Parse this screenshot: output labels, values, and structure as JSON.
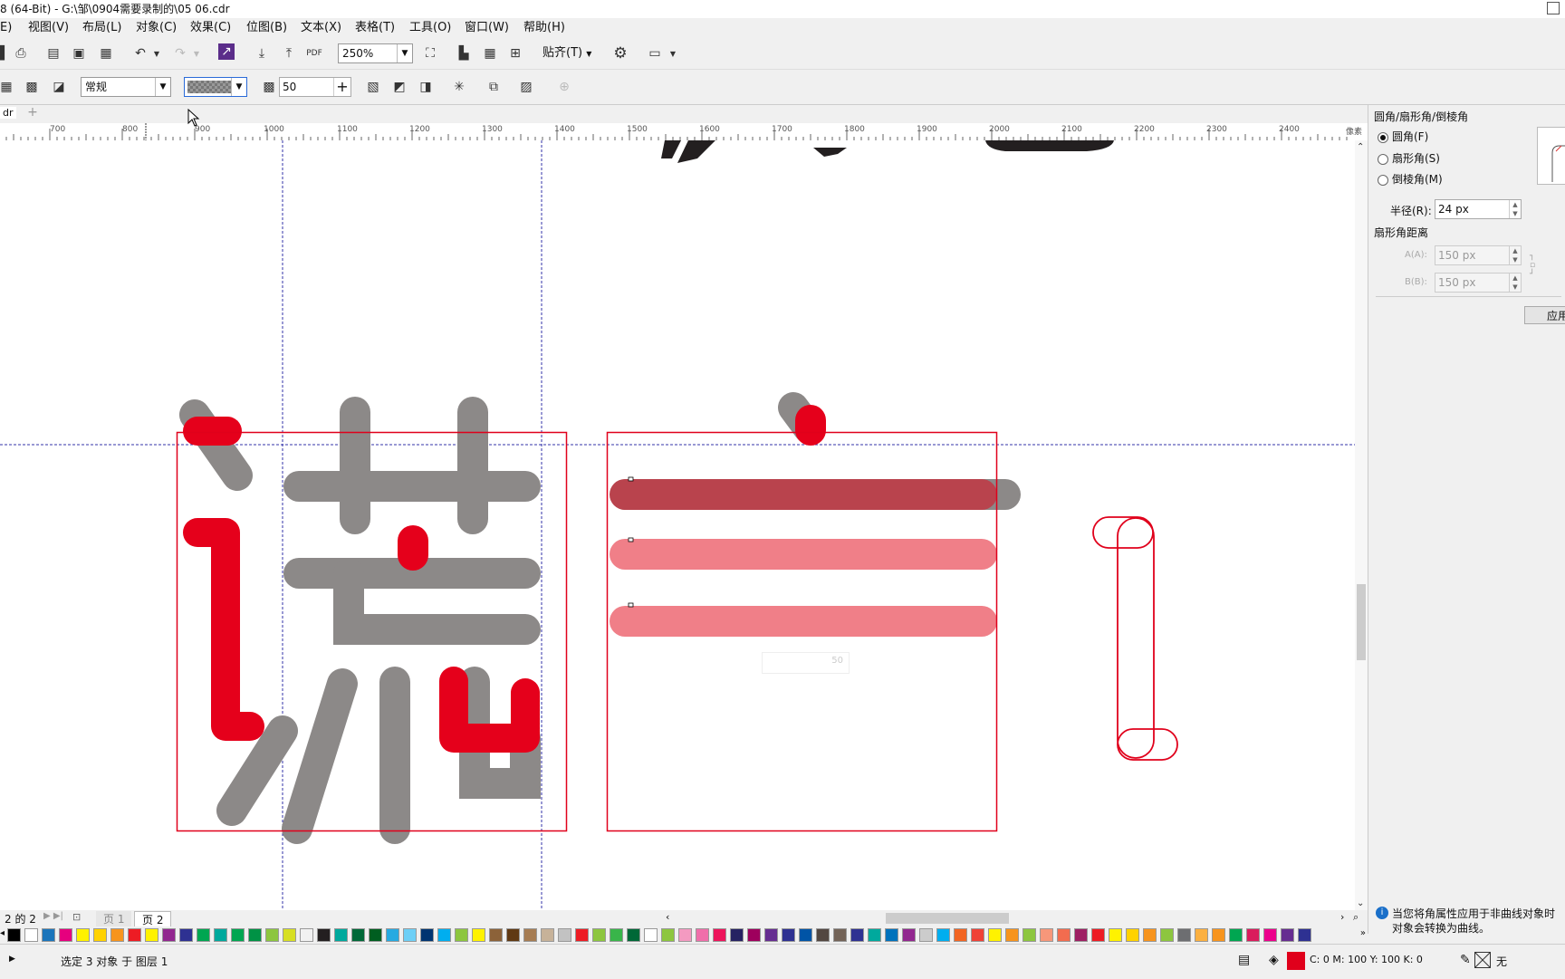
{
  "window": {
    "title": "8 (64-Bit) - G:\\邹\\0904需要录制的\\05 06.cdr"
  },
  "menu": [
    "E)",
    "视图(V)",
    "布局(L)",
    "对象(C)",
    "效果(C)",
    "位图(B)",
    "文本(X)",
    "表格(T)",
    "工具(O)",
    "窗口(W)",
    "帮助(H)"
  ],
  "toolbar": {
    "zoom_value": "250%",
    "snap_label": "贴齐(T)"
  },
  "propbar": {
    "merge_mode": "常规",
    "transparency_value": "50"
  },
  "document_tab": {
    "label": "dr"
  },
  "ruler": {
    "unit": "像素",
    "ticks": [
      "700",
      "800",
      "900",
      "1000",
      "1100",
      "1200",
      "1300",
      "1400",
      "1500",
      "1600",
      "1700",
      "1800",
      "1900",
      "2000",
      "2100",
      "2200",
      "2300",
      "2400"
    ]
  },
  "canvas": {
    "floating_value": "50"
  },
  "panel": {
    "title": "圆角/扇形角/倒棱角",
    "options": [
      "圆角(F)",
      "扇形角(S)",
      "倒棱角(M)"
    ],
    "selected_option": 0,
    "radius_label": "半径(R):",
    "radius_value": "24 px",
    "scallop_label": "扇形角距离",
    "a_label": "A(A):",
    "a_value": "150 px",
    "b_label": "B(B):",
    "b_value": "150 px",
    "apply_label": "应用",
    "info_text_1": "当您将角属性应用于非曲线对象时",
    "info_text_2": "对象会转换为曲线。"
  },
  "pages": {
    "counter": "2 的 2",
    "page1": "页 1",
    "page2": "页 2"
  },
  "status": {
    "selection": "选定 3 对象 于 图层 1",
    "fill_color": "#e0001b",
    "fill_info": "C: 0 M: 100 Y: 100 K: 0",
    "outline": "无"
  },
  "palette": [
    "#000000",
    "#ffffff",
    "#1b75bb",
    "#e6007e",
    "#fff200",
    "#ffd200",
    "#f7941d",
    "#ed1c24",
    "#fff200",
    "#92278f",
    "#2e3192",
    "#00a651",
    "#00a99d",
    "#00a651",
    "#009245",
    "#8dc63f",
    "#d7df23",
    "#f1f1f1",
    "#231f20",
    "#00a99d",
    "#006838",
    "#005e20",
    "#27aae1",
    "#6dcff6",
    "#003471",
    "#00aeef",
    "#8dc63f",
    "#fff200",
    "#8c6239",
    "#603913",
    "#a67c52",
    "#c7b299",
    "#c2c2c2",
    "#ed1c24",
    "#8dc63f",
    "#39b54a",
    "#006837",
    "#ffffff",
    "#8dc63f",
    "#f49ac1",
    "#f06eaa",
    "#ed145b",
    "#262262",
    "#9e005d",
    "#662d91",
    "#2e3192",
    "#0054a6",
    "#534741",
    "#736357",
    "#2e3192",
    "#00a99d",
    "#0072bc",
    "#92278f",
    "#cccccc",
    "#00aeef",
    "#f26522",
    "#ef4136",
    "#fff200",
    "#f7941d",
    "#8dc63f",
    "#f7977a",
    "#f26c4f",
    "#9e1f63",
    "#ed1c24",
    "#fff200",
    "#ffd200",
    "#f7941d",
    "#8dc63f",
    "#6d6e71",
    "#fbb040",
    "#f7941d",
    "#00a651",
    "#da1c5c",
    "#ec008c",
    "#662d91",
    "#2e3192"
  ]
}
